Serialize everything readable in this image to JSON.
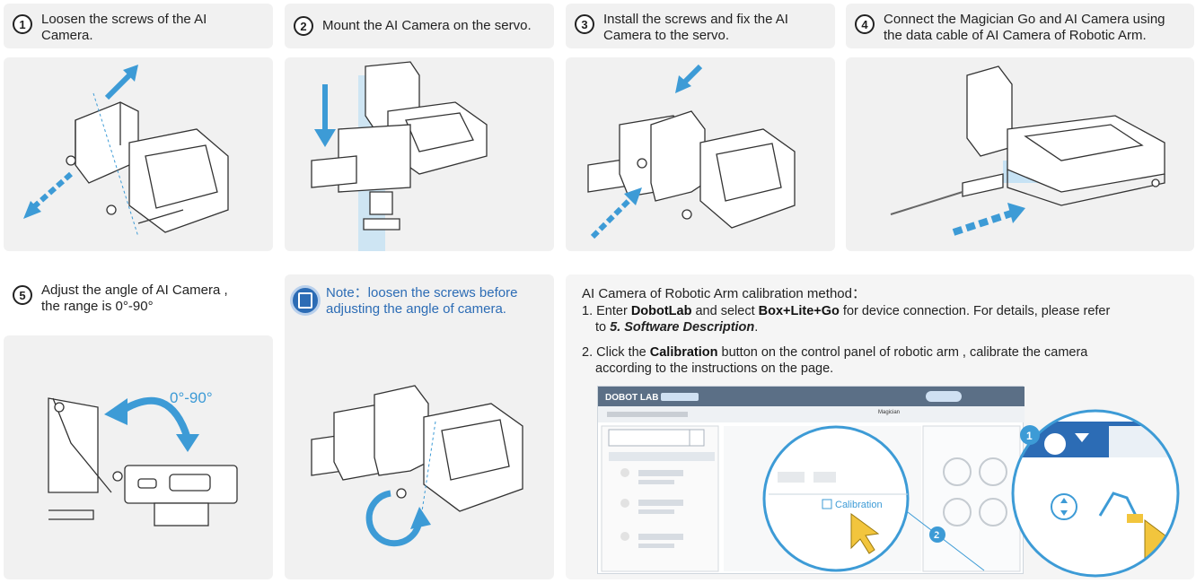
{
  "steps": [
    {
      "num": "1",
      "text": "Loosen the screws of the AI Camera."
    },
    {
      "num": "2",
      "text": "Mount the AI Camera on the servo."
    },
    {
      "num": "3",
      "text": "Install the screws and fix the AI Camera  to the servo."
    },
    {
      "num": "4",
      "text": "Connect the Magician Go and AI Camera using the data cable of AI Camera of Robotic Arm."
    },
    {
      "num": "5",
      "text": "Adjust the angle of AI Camera , the range is 0°-90°"
    }
  ],
  "angle_label": "0°-90°",
  "note": {
    "text": "Note：loosen the screws before adjusting the angle of camera.",
    "icon": "book-icon"
  },
  "calibration": {
    "title": "AI Camera of Robotic Arm calibration method：",
    "step1": {
      "prefix": "1. Enter ",
      "app": "DobotLab",
      "mid": " and select ",
      "device": "Box+Lite+Go",
      "suffix": " for device connection. For details, please refer",
      "line2_pre": "to ",
      "ref": "5. Software Description",
      "line2_post": "."
    },
    "step2": {
      "prefix": "2. Click the ",
      "button": "Calibration",
      "suffix": " button on the control panel of robotic arm , calibrate the camera",
      "line2": "according to the instructions on the page."
    }
  },
  "screenshot": {
    "logo": "DOBOT LAB",
    "device_name": "Magician",
    "calibration_button": "Calibration",
    "callout_1": "1",
    "callout_2": "2"
  },
  "colors": {
    "accent_blue": "#2c6cb5",
    "arrow_blue": "#3d9bd6",
    "cursor_yellow": "#f2c53d",
    "panel_bg": "#f1f1f1"
  }
}
